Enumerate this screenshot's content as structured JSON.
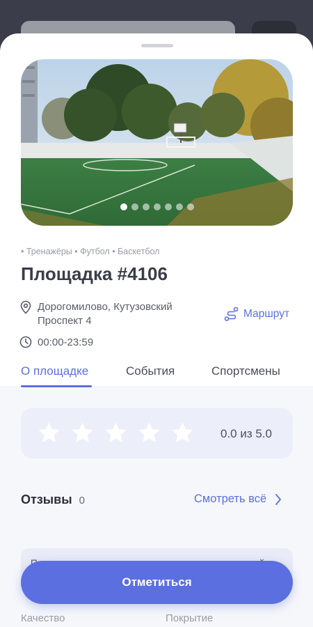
{
  "venue": {
    "tags": "• Тренажёры • Футбол • Баскетбол",
    "title": "Площадка #4106",
    "address": "Дорогомилово, Кутузовский Проспект 4",
    "route_label": "Маршрут",
    "hours": "00:00-23:59",
    "photo": {
      "count": 7,
      "active_index": 0
    }
  },
  "tabs": [
    {
      "label": "О площадке",
      "active": true
    },
    {
      "label": "События",
      "active": false
    },
    {
      "label": "Спортсмены",
      "active": false
    }
  ],
  "rating": {
    "value": 0.0,
    "max": 5,
    "text": "0.0 из 5.0"
  },
  "reviews": {
    "title": "Отзывы",
    "count": "0",
    "see_all_label": "Смотреть всё",
    "empty_text": "Пользователи пока не оставляли комментарии к этой площадке, Будте первым!"
  },
  "peek": {
    "left": "Качество",
    "right": "Покрытие"
  },
  "actions": {
    "checkin_label": "Отметиться"
  },
  "colors": {
    "accent": "#5b6fe0",
    "rating_bg": "#eceef9",
    "star_empty": "#ffffff"
  },
  "icons": {
    "address": "location-pin-icon",
    "route": "route-icon",
    "hours": "clock-icon",
    "see_all": "chevron-right-icon",
    "rating": "star-icon"
  }
}
